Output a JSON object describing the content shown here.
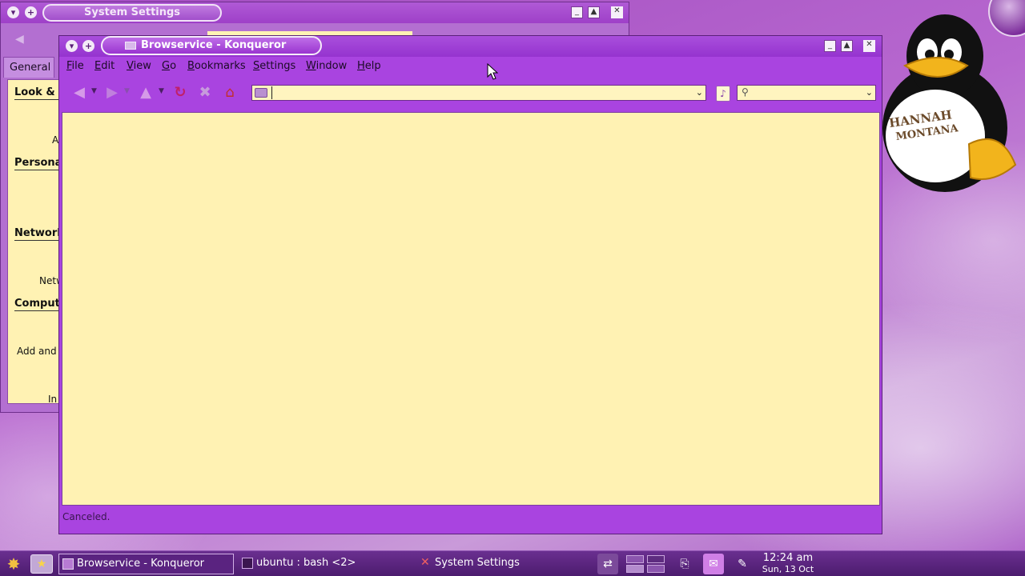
{
  "desktop": {
    "mascot_text": "HANNAH MONTANA"
  },
  "system_settings_window": {
    "title": "System Settings",
    "tab": "General",
    "sections": [
      {
        "label": "Look & Feel"
      },
      {
        "label": "Personal"
      },
      {
        "label": "Network"
      },
      {
        "label": "Computer"
      }
    ],
    "items": [
      "A",
      "Netw",
      "Add and",
      "In"
    ]
  },
  "konqueror_window": {
    "title": "Browservice - Konqueror",
    "menu": [
      "File",
      "Edit",
      "View",
      "Go",
      "Bookmarks",
      "Settings",
      "Window",
      "Help"
    ],
    "toolbar": {
      "back_icon": "back-arrow-icon",
      "forward_icon": "forward-arrow-icon",
      "up_icon": "up-arrow-icon",
      "reload_icon": "reload-icon",
      "stop_icon": "stop-icon",
      "home_icon": "home-icon"
    },
    "location": {
      "value": "",
      "placeholder": ""
    },
    "search": {
      "value": ""
    },
    "status": "Canceled."
  },
  "taskbar": {
    "tasks": [
      {
        "label": "Browservice - Konqueror",
        "active": true
      },
      {
        "label": "ubuntu : bash <2>",
        "active": false
      },
      {
        "label": "System Settings",
        "active": false
      }
    ],
    "clock": {
      "time": "12:24 am",
      "date": "Sun, 13 Oct"
    }
  },
  "colors": {
    "window_accent": "#a944e0",
    "content_bg": "#fff2b3",
    "taskbar": "#4c1c6e"
  }
}
